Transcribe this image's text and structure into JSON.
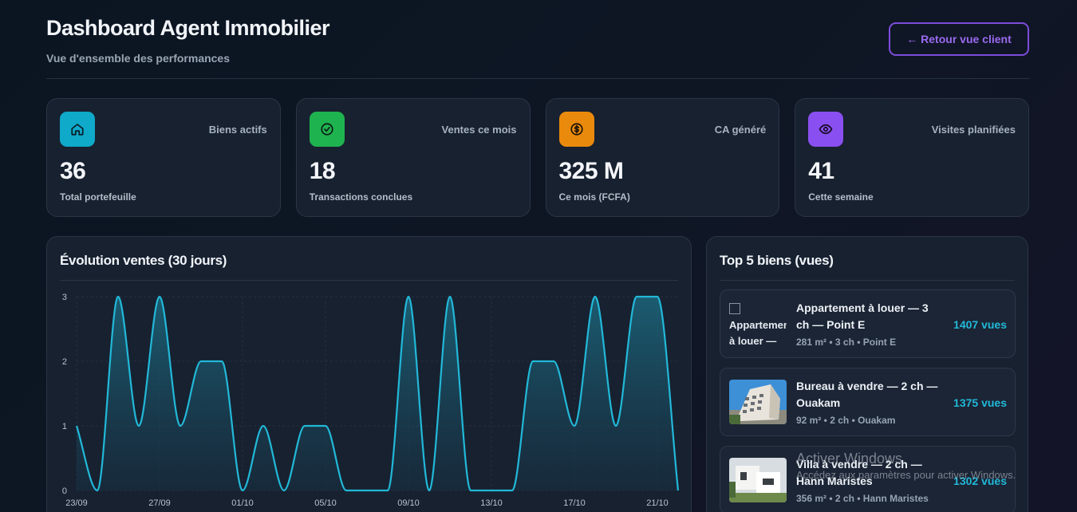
{
  "header": {
    "title": "Dashboard Agent Immobilier",
    "subtitle": "Vue d'ensemble des performances",
    "back_button": "← Retour vue client"
  },
  "stats": [
    {
      "label": "Biens actifs",
      "value": "36",
      "sub": "Total portefeuille",
      "icon": "home-icon",
      "color": "#0fa9c9"
    },
    {
      "label": "Ventes ce mois",
      "value": "18",
      "sub": "Transactions conclues",
      "icon": "check-circle-icon",
      "color": "#1fb34f"
    },
    {
      "label": "CA généré",
      "value": "325 M",
      "sub": "Ce mois (FCFA)",
      "icon": "dollar-circle-icon",
      "color": "#ea8a0c"
    },
    {
      "label": "Visites planifiées",
      "value": "41",
      "sub": "Cette semaine",
      "icon": "eye-icon",
      "color": "#8a4ff0"
    }
  ],
  "chart_panel": {
    "title": "Évolution ventes (30 jours)"
  },
  "chart_data": {
    "type": "area",
    "title": "Évolution ventes (30 jours)",
    "x": [
      "23/09",
      "24/09",
      "25/09",
      "26/09",
      "27/09",
      "28/09",
      "29/09",
      "30/09",
      "01/10",
      "02/10",
      "03/10",
      "04/10",
      "05/10",
      "06/10",
      "07/10",
      "08/10",
      "09/10",
      "10/10",
      "11/10",
      "12/10",
      "13/10",
      "14/10",
      "15/10",
      "16/10",
      "17/10",
      "18/10",
      "19/10",
      "20/10",
      "21/10",
      "22/10"
    ],
    "tick_labels": [
      "23/09",
      "27/09",
      "01/10",
      "05/10",
      "09/10",
      "13/10",
      "17/10",
      "21/10"
    ],
    "values": [
      1,
      0,
      3,
      1,
      3,
      1,
      2,
      2,
      0,
      1,
      0,
      1,
      1,
      0,
      0,
      0,
      3,
      0,
      3,
      0,
      0,
      0,
      2,
      2,
      1,
      3,
      1,
      3,
      3,
      0
    ],
    "ylim": [
      0,
      3
    ],
    "yticks": [
      0,
      1,
      2,
      3
    ],
    "grid": true,
    "color": "#22b8d8"
  },
  "top_panel": {
    "title": "Top 5 biens (vues)",
    "items": [
      {
        "title": "Appartement à louer — 3 ch — Point E",
        "meta": "281 m² • 3 ch • Point E",
        "views": "1407 vues",
        "alt": "Appartement à louer —"
      },
      {
        "title": "Bureau à vendre — 2 ch — Ouakam",
        "meta": "92 m² • 2 ch • Ouakam",
        "views": "1375 vues"
      },
      {
        "title": "Villa à vendre — 2 ch — Hann Maristes",
        "meta": "356 m² • 2 ch • Hann Maristes",
        "views": "1302 vues"
      }
    ]
  },
  "watermark": {
    "line1": "Activer Windows",
    "line2": "Accédez aux paramètres pour activer Windows."
  }
}
